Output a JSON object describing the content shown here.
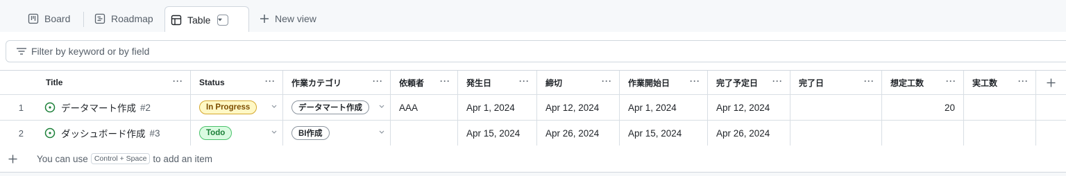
{
  "tabs": [
    {
      "label": "Board",
      "icon": "board-icon"
    },
    {
      "label": "Roadmap",
      "icon": "roadmap-icon"
    },
    {
      "label": "Table",
      "icon": "table-icon"
    }
  ],
  "new_view_label": "New view",
  "filter": {
    "placeholder": "Filter by keyword or by field"
  },
  "columns": [
    {
      "label": "Title"
    },
    {
      "label": "Status"
    },
    {
      "label": "作業カテゴリ"
    },
    {
      "label": "依頼者"
    },
    {
      "label": "発生日"
    },
    {
      "label": "締切"
    },
    {
      "label": "作業開始日"
    },
    {
      "label": "完了予定日"
    },
    {
      "label": "完了日"
    },
    {
      "label": "想定工数"
    },
    {
      "label": "実工数"
    }
  ],
  "menu_glyph": "···",
  "rows": [
    {
      "num": "1",
      "title": "データマート作成",
      "issue": "#2",
      "status": "In Progress",
      "category": "データマート作成",
      "requester": "AAA",
      "occurred": "Apr 1, 2024",
      "deadline": "Apr 12, 2024",
      "start": "Apr 1, 2024",
      "planned_end": "Apr 12, 2024",
      "done": "",
      "est": "20",
      "actual": ""
    },
    {
      "num": "2",
      "title": "ダッシュボード作成",
      "issue": "#3",
      "status": "Todo",
      "category": "BI作成",
      "requester": "",
      "occurred": "Apr 15, 2024",
      "deadline": "Apr 26, 2024",
      "start": "Apr 15, 2024",
      "planned_end": "Apr 26, 2024",
      "done": "",
      "est": "",
      "actual": ""
    }
  ],
  "footer": {
    "prefix": "You can use",
    "kbd": "Control + Space",
    "suffix": "to add an item"
  },
  "colors": {
    "in_progress_bg": "#fff8c5",
    "in_progress_border": "#d4a72c",
    "in_progress_text": "#7d4e00",
    "todo_bg": "#dafbe1",
    "todo_border": "#4ac26b",
    "todo_text": "#1a7f37",
    "open_issue": "#1a7f37"
  }
}
